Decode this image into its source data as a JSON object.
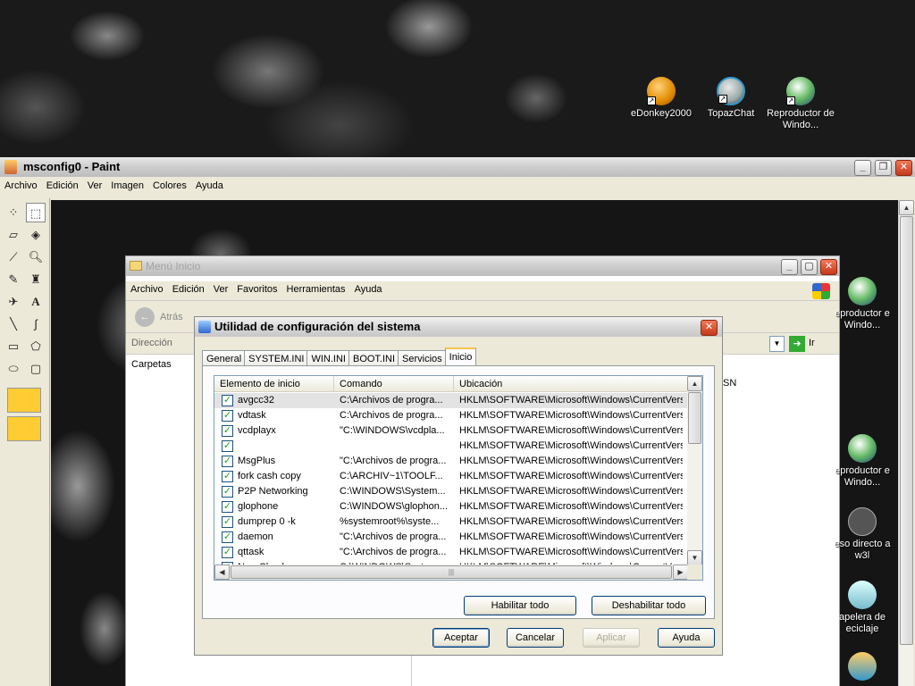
{
  "desktop": {
    "icons": [
      {
        "label": "eDonkey2000"
      },
      {
        "label": "TopazChat"
      },
      {
        "label": "Reproductor de Windo..."
      },
      {
        "label": "eproductor e Windo..."
      },
      {
        "label": "eproductor e Windo..."
      },
      {
        "label": "eso directo a w3l"
      },
      {
        "label": "apelera de eciclaje"
      }
    ]
  },
  "paint": {
    "title": "msconfig0 - Paint",
    "menu": [
      "Archivo",
      "Edición",
      "Ver",
      "Imagen",
      "Colores",
      "Ayuda"
    ]
  },
  "explorer": {
    "title": "Menú Inicio",
    "menu": [
      "Archivo",
      "Edición",
      "Ver",
      "Favoritos",
      "Herramientas",
      "Ayuda"
    ],
    "back_label": "Atrás",
    "address_label": "Dirección",
    "go_label": "Ir",
    "folders_label": "Carpetas",
    "right_text": "SN"
  },
  "msconfig": {
    "title": "Utilidad de configuración del sistema",
    "tabs": [
      "General",
      "SYSTEM.INI",
      "WIN.INI",
      "BOOT.INI",
      "Servicios",
      "Inicio"
    ],
    "active_tab": "Inicio",
    "columns": [
      "Elemento de inicio",
      "Comando",
      "Ubicación"
    ],
    "rows": [
      {
        "name": "avgcc32",
        "command": "C:\\Archivos de progra...",
        "location": "HKLM\\SOFTWARE\\Microsoft\\Windows\\CurrentVersi...",
        "checked": true,
        "selected": true
      },
      {
        "name": "vdtask",
        "command": "C:\\Archivos de progra...",
        "location": "HKLM\\SOFTWARE\\Microsoft\\Windows\\CurrentVersi...",
        "checked": true
      },
      {
        "name": "vcdplayx",
        "command": "\"C:\\WINDOWS\\vcdpla...",
        "location": "HKLM\\SOFTWARE\\Microsoft\\Windows\\CurrentVersi...",
        "checked": true
      },
      {
        "name": "",
        "command": "",
        "location": "HKLM\\SOFTWARE\\Microsoft\\Windows\\CurrentVersi...",
        "checked": true
      },
      {
        "name": "MsgPlus",
        "command": "\"C:\\Archivos de progra...",
        "location": "HKLM\\SOFTWARE\\Microsoft\\Windows\\CurrentVersi...",
        "checked": true
      },
      {
        "name": "fork cash copy",
        "command": "C:\\ARCHIV~1\\TOOLF...",
        "location": "HKLM\\SOFTWARE\\Microsoft\\Windows\\CurrentVersi...",
        "checked": true
      },
      {
        "name": "P2P Networking",
        "command": "C:\\WINDOWS\\System...",
        "location": "HKLM\\SOFTWARE\\Microsoft\\Windows\\CurrentVersi...",
        "checked": true
      },
      {
        "name": "glophone",
        "command": "C:\\WINDOWS\\glophon...",
        "location": "HKLM\\SOFTWARE\\Microsoft\\Windows\\CurrentVersi...",
        "checked": true
      },
      {
        "name": "dumprep 0 -k",
        "command": "%systemroot%\\syste...",
        "location": "HKLM\\SOFTWARE\\Microsoft\\Windows\\CurrentVersi...",
        "checked": true
      },
      {
        "name": "daemon",
        "command": "\"C:\\Archivos de progra...",
        "location": "HKLM\\SOFTWARE\\Microsoft\\Windows\\CurrentVersi...",
        "checked": true
      },
      {
        "name": "qttask",
        "command": "\"C:\\Archivos de progra...",
        "location": "HKLM\\SOFTWARE\\Microsoft\\Windows\\CurrentVersi...",
        "checked": true
      },
      {
        "name": "NeroCheck",
        "command": "C:\\WINDOWS\\System...",
        "location": "HKLM\\SOFTWARE\\Microsoft\\Windows\\CurrentVersi...",
        "checked": true
      }
    ],
    "enable_all": "Habilitar todo",
    "disable_all": "Deshabilitar todo",
    "ok": "Aceptar",
    "cancel": "Cancelar",
    "apply": "Aplicar",
    "help": "Ayuda"
  }
}
